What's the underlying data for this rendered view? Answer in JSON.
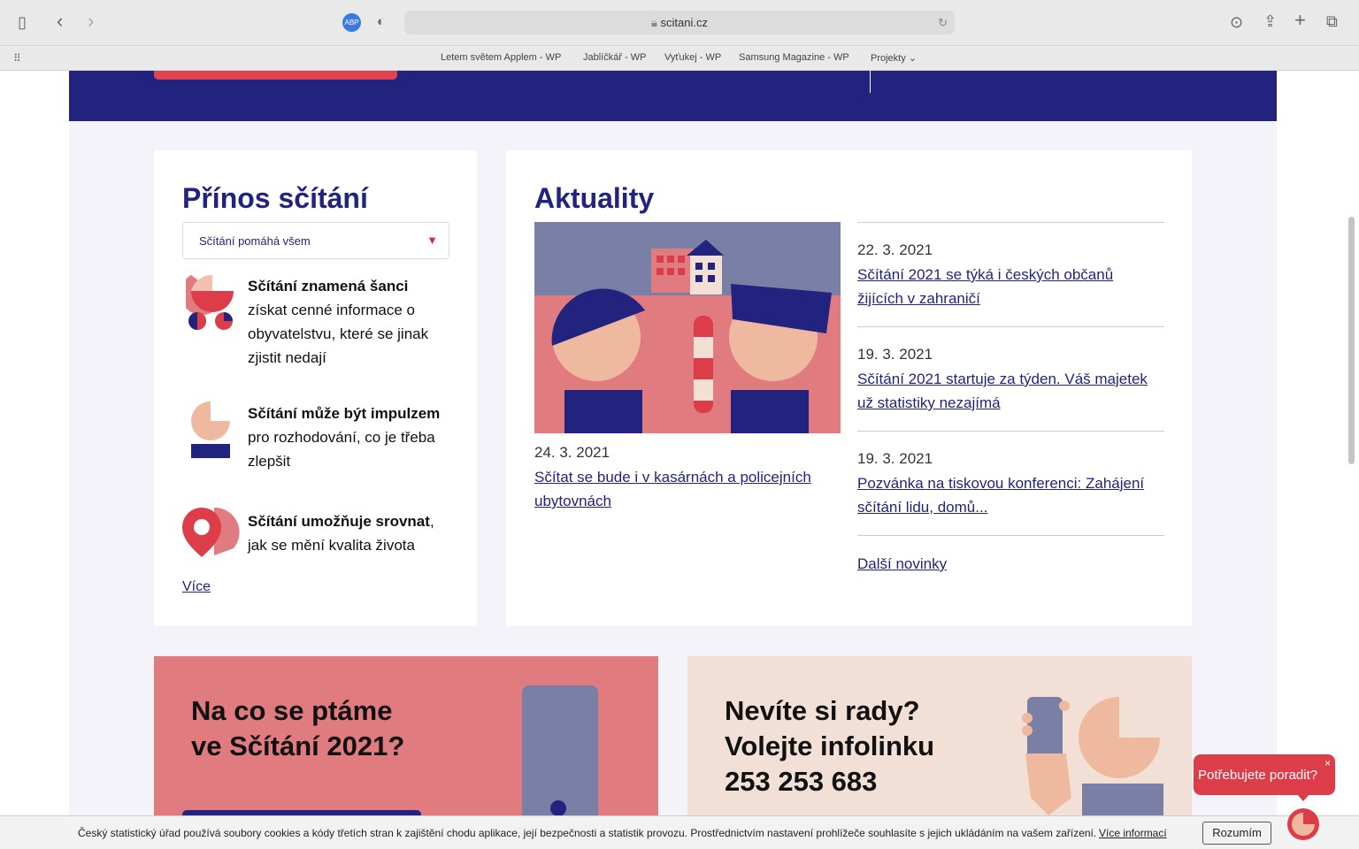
{
  "browser": {
    "url": "scitani.cz",
    "bookmarks": [
      "Letem světem Applem - WP",
      "Jablíčkář - WP",
      "Vyťukej - WP",
      "Samsung Magazine - WP",
      "Projekty"
    ],
    "adblock_label": "ABP"
  },
  "benefits": {
    "title": "Přínos sčítání",
    "select_value": "Sčítání pomáhá všem",
    "items": [
      {
        "bold": "Sčítání znamená šanci",
        "rest": " získat cenné informace o obyvatelstvu, které se jinak zjistit nedají"
      },
      {
        "bold": "Sčítání může být impulzem",
        "rest": " pro rozhodování, co je třeba zlepšit"
      },
      {
        "bold": "Sčítání umožňuje srovnat",
        "rest": ", jak se mění kvalita života"
      }
    ],
    "more": "Více"
  },
  "news": {
    "title": "Aktuality",
    "featured": {
      "date": "24. 3. 2021",
      "title": "Sčítat se bude i v kasárnách a policejních ubytovnách"
    },
    "items": [
      {
        "date": "22. 3. 2021",
        "title": "Sčítání 2021 se týká i českých občanů žijících v zahraničí"
      },
      {
        "date": "19. 3. 2021",
        "title": "Sčítání 2021 startuje za týden. Váš majetek už statistiky nezajímá"
      },
      {
        "date": "19. 3. 2021",
        "title": "Pozvánka na tiskovou konferenci: Zahájení sčítání lidu, domů..."
      }
    ],
    "more": "Další novinky"
  },
  "promo": {
    "left_title_1": "Na co se ptáme",
    "left_title_2": "ve Sčítání 2021?",
    "right_title_1": "Nevíte si rady?",
    "right_title_2": "Volejte infolinku",
    "phone": "253 253 683"
  },
  "cookie": {
    "text": "Český statistický úřad používá soubory cookies a kódy třetích stran k zajištění chodu aplikace, její bezpečnosti a statistik provozu. Prostřednictvím nastavení prohlížeče souhlasíte s jejich ukládáním na vašem zařízení.",
    "more": "Více informací",
    "accept": "Rozumím"
  },
  "help": {
    "label": "Potřebujete poradit?",
    "close": "×"
  },
  "colors": {
    "navy": "#22237f",
    "red": "#dd3d48",
    "pink": "#e07b80",
    "peach": "#efb9a0",
    "slate": "#7a7fa5",
    "beige": "#f2e0d6"
  }
}
